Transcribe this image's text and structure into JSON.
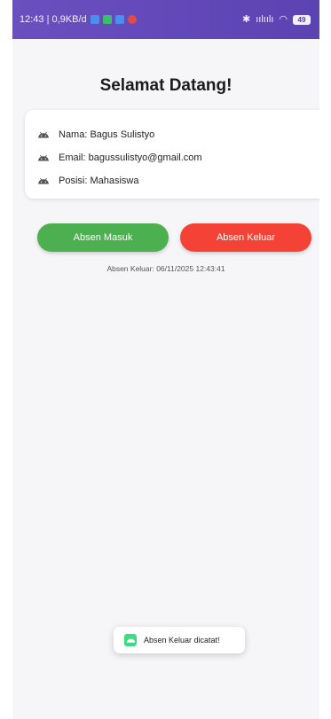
{
  "statusbar": {
    "time_net": "12:43 | 0,9KB/d",
    "signal": "ıılıılı",
    "battery": "49"
  },
  "header": {
    "title": "Selamat Datang!"
  },
  "profile": {
    "name": "Nama: Bagus Sulistyo",
    "email": "Email: bagussulistyo@gmail.com",
    "position": "Posisi: Mahasiswa"
  },
  "actions": {
    "masuk_label": "Absen Masuk",
    "keluar_label": "Absen Keluar"
  },
  "status_text": "Absen Keluar: 06/11/2025 12:43:41",
  "toast": {
    "message": "Absen Keluar dicatat!"
  },
  "colors": {
    "status_bar": "#5b43b2",
    "masuk": "#4caf50",
    "keluar": "#f44336",
    "android": "#3ddc84"
  },
  "icons": {
    "row": "android-icon",
    "toast": "android-icon"
  }
}
